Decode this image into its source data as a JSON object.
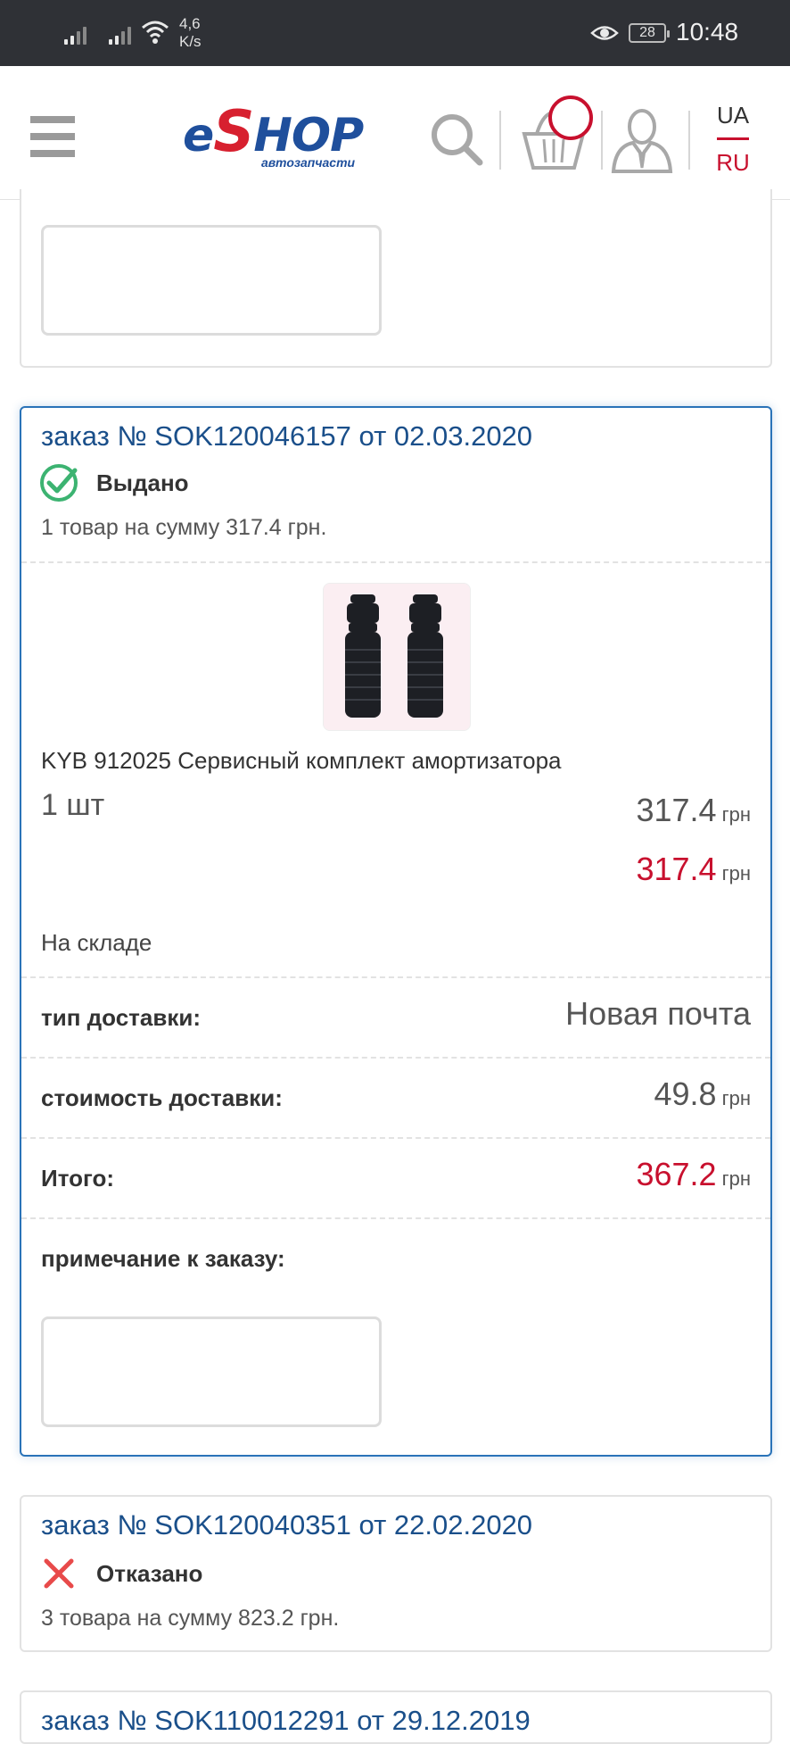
{
  "status_bar": {
    "speed_value": "4,6",
    "speed_unit": "K/s",
    "battery": "28",
    "time": "10:48"
  },
  "header": {
    "logo": {
      "prefix": "e",
      "letter": "S",
      "rest": "HOP",
      "subtitle": "автозапчасти"
    },
    "icons": [
      "menu-icon",
      "search-icon",
      "cart-icon",
      "user-icon"
    ],
    "lang_ua": "UA",
    "lang_ru": "RU",
    "active_lang": "RU"
  },
  "orders": [
    {
      "title": "заказ № SOK120046157 от 02.03.2020",
      "status": "Выдано",
      "status_icon": "check-circle-icon",
      "summary": "1 товар на сумму 317.4 грн.",
      "item": {
        "name": "KYB 912025 Сервисный комплект амортизатора",
        "qty": "1 шт",
        "price": "317.4",
        "total": "317.4",
        "currency": "грн",
        "stock": "На складе"
      },
      "delivery_type_label": "тип доставки:",
      "delivery_type_value": "Новая почта",
      "delivery_cost_label": "стоимость доставки:",
      "delivery_cost_value": "49.8",
      "total_label": "Итого:",
      "total_value": "367.2",
      "currency": "грн",
      "note_label": "примечание к заказу:"
    },
    {
      "title": "заказ № SOK120040351 от 22.02.2020",
      "status": "Отказано",
      "status_icon": "cross-icon",
      "summary": "3 товара на сумму 823.2 грн."
    },
    {
      "title": "заказ № SOK110012291 от 29.12.2019"
    }
  ],
  "colors": {
    "accent_blue": "#1a4f8a",
    "price_red": "#c8102e",
    "success_green": "#3cb371",
    "error_red": "#e84a4a"
  }
}
